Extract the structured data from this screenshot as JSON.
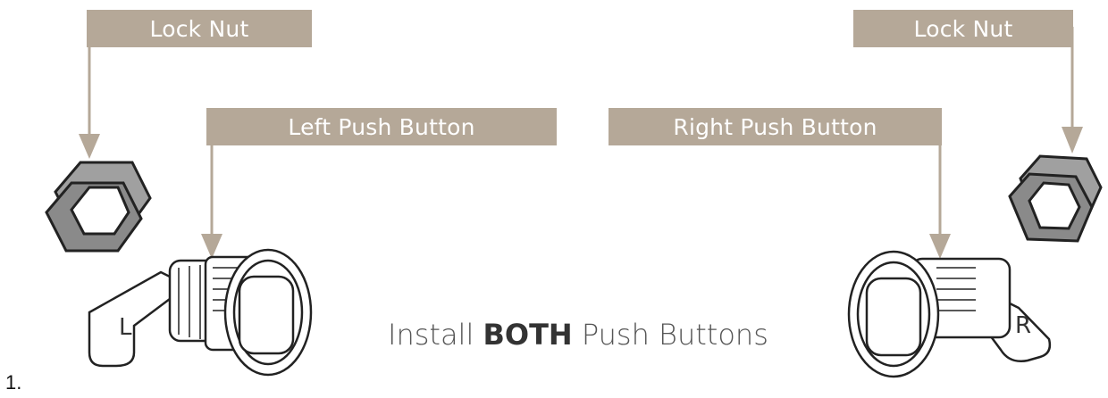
{
  "labels": {
    "lock_nut_left": "Lock Nut",
    "left_push_button": "Left Push Button",
    "right_push_button": "Right Push Button",
    "lock_nut_right": "Lock Nut"
  },
  "caption": {
    "prefix": "Install ",
    "emphasis": "BOTH",
    "suffix": " Push Buttons"
  },
  "step_number": "1.",
  "part_marks": {
    "left_latch_letter": "L",
    "right_latch_letter": "R"
  },
  "colors": {
    "label_background": "#b5a898",
    "label_text": "#ffffff",
    "arrow": "#b5a898",
    "outline": "#222222",
    "nut_gray": "#8a8a8a"
  }
}
